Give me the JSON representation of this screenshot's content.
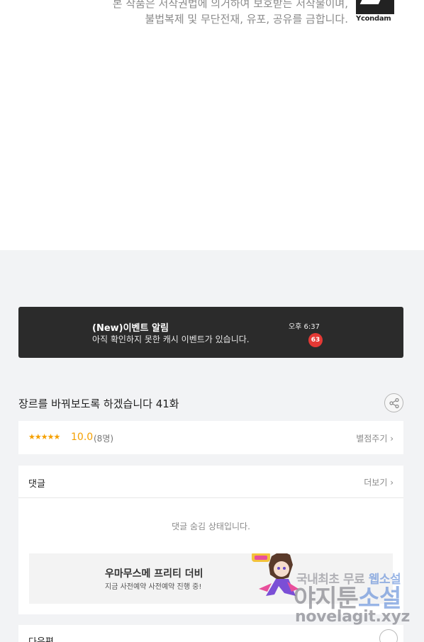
{
  "copyright": {
    "line1": "본 작품은 저작권법에 의거하여 보호받는 저작물이며,",
    "line2": "불법복제 및 무단전재, 유포, 공유를 금합니다.",
    "logo_text": "Ycondam"
  },
  "event_banner": {
    "title": "(New)이벤트 알림",
    "description": "아직 확인하지 못한 캐시 이벤트가 있습니다.",
    "time": "오후 6:37",
    "badge_count": "63",
    "badge_color": "#e53935"
  },
  "episode": {
    "title": "장르를 바꿔보도록 하겠습니다 41화",
    "share_icon": "share-icon"
  },
  "rating": {
    "stars": "★★★★★",
    "score": "10.0",
    "count": "(8명)",
    "rate_label": "별점주기 ›",
    "accent_color": "#f5a000"
  },
  "comments": {
    "title": "댓글",
    "more_label": "더보기 ›",
    "hidden_message": "댓글 숨김 상태입니다."
  },
  "ad": {
    "title": "우마무스메 프리티 더비",
    "description": "지금 사전예약 사전예약 진행 중!"
  },
  "watermark": {
    "line1_a": "국내최초 무료 ",
    "line1_b": "웹소설",
    "line2_a": "야지툰",
    "line2_b": "소설",
    "line3": "novelagit.xyz"
  },
  "next": {
    "title": "다음편"
  }
}
